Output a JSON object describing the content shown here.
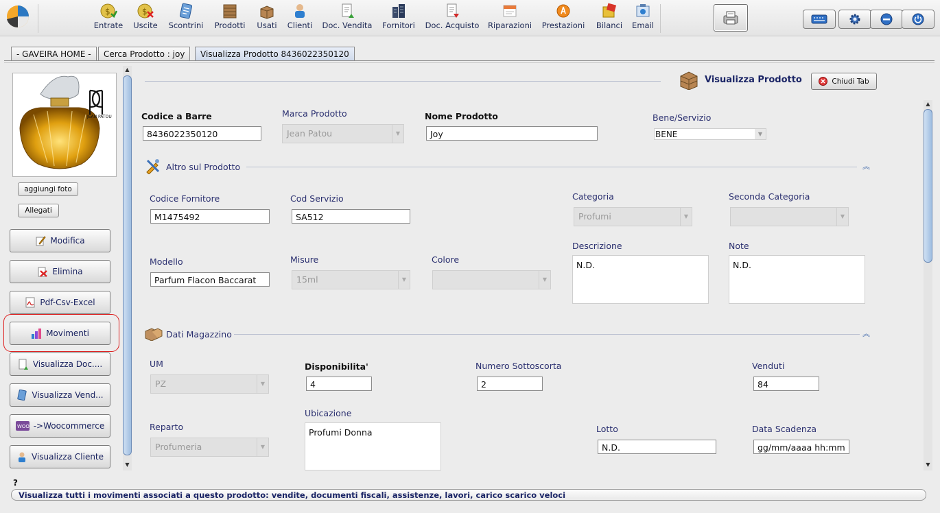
{
  "toolbar": {
    "items": [
      {
        "label": "Entrate",
        "icon": "coin-in-icon"
      },
      {
        "label": "Uscite",
        "icon": "coin-out-icon"
      },
      {
        "label": "Scontrini",
        "icon": "receipt-icon"
      },
      {
        "label": "Prodotti",
        "icon": "box-icon"
      },
      {
        "label": "Usati",
        "icon": "open-box-icon"
      },
      {
        "label": "Clienti",
        "icon": "customer-icon"
      },
      {
        "label": "Doc. Vendita",
        "icon": "sale-document-icon"
      },
      {
        "label": "Fornitori",
        "icon": "supplier-icon"
      },
      {
        "label": "Doc. Acquisto",
        "icon": "purchase-document-icon"
      },
      {
        "label": "Riparazioni",
        "icon": "repair-icon"
      },
      {
        "label": "Prestazioni",
        "icon": "service-icon"
      },
      {
        "label": "Bilanci",
        "icon": "balance-icon"
      },
      {
        "label": "Email",
        "icon": "email-icon"
      }
    ]
  },
  "tabs": [
    {
      "label": "- GAVEIRA HOME -"
    },
    {
      "label": "Cerca Prodotto : joy"
    },
    {
      "label": "Visualizza Prodotto 8436022350120"
    }
  ],
  "product_image": {
    "brand_text": "JEAN PATOU"
  },
  "left": {
    "add_photo": "aggiungi foto",
    "attachments": "Allegati",
    "buttons": [
      {
        "label": "Modifica"
      },
      {
        "label": "Elimina"
      },
      {
        "label": "Pdf-Csv-Excel"
      },
      {
        "label": "Movimenti"
      },
      {
        "label": "Visualizza Doc...."
      },
      {
        "label": "Visualizza Vend..."
      },
      {
        "label": "->Woocommerce"
      },
      {
        "label": "Visualizza Cliente"
      }
    ]
  },
  "header": {
    "title": "Visualizza Prodotto",
    "close_tab": "Chiudi Tab"
  },
  "form": {
    "barcode_label": "Codice a Barre",
    "barcode": "8436022350120",
    "brand_label": "Marca Prodotto",
    "brand": "Jean Patou",
    "name_label": "Nome Prodotto",
    "name": "Joy",
    "type_label": "Bene/Servizio",
    "type": "BENE",
    "section_other": "Altro sul Prodotto",
    "supplier_code_label": "Codice Fornitore",
    "supplier_code": "M1475492",
    "service_code_label": "Cod Servizio",
    "service_code": "SA512",
    "category_label": "Categoria",
    "category": "Profumi",
    "second_category_label": "Seconda Categoria",
    "second_category": "",
    "model_label": "Modello",
    "model": "Parfum Flacon Baccarat",
    "size_label": "Misure",
    "size": "15ml",
    "color_label": "Colore",
    "color": "",
    "description_label": "Descrizione",
    "description": "N.D.",
    "notes_label": "Note",
    "notes": "N.D.",
    "section_warehouse": "Dati Magazzino",
    "um_label": "UM",
    "um": "PZ",
    "availability_label": "Disponibilita'",
    "availability": "4",
    "understock_label": "Numero Sottoscorta",
    "understock": "2",
    "sold_label": "Venduti",
    "sold": "84",
    "department_label": "Reparto",
    "department": "Profumeria",
    "location_label": "Ubicazione",
    "location": "Profumi Donna",
    "lot_label": "Lotto",
    "lot": "N.D.",
    "expiry_label": "Data Scadenza",
    "expiry": "gg/mm/aaaa hh:mm"
  },
  "status": {
    "help": "?",
    "text": "Visualizza tutti i movimenti associati a questo prodotto: vendite, documenti fiscali, assistenze, lavori, carico scarico veloci"
  }
}
